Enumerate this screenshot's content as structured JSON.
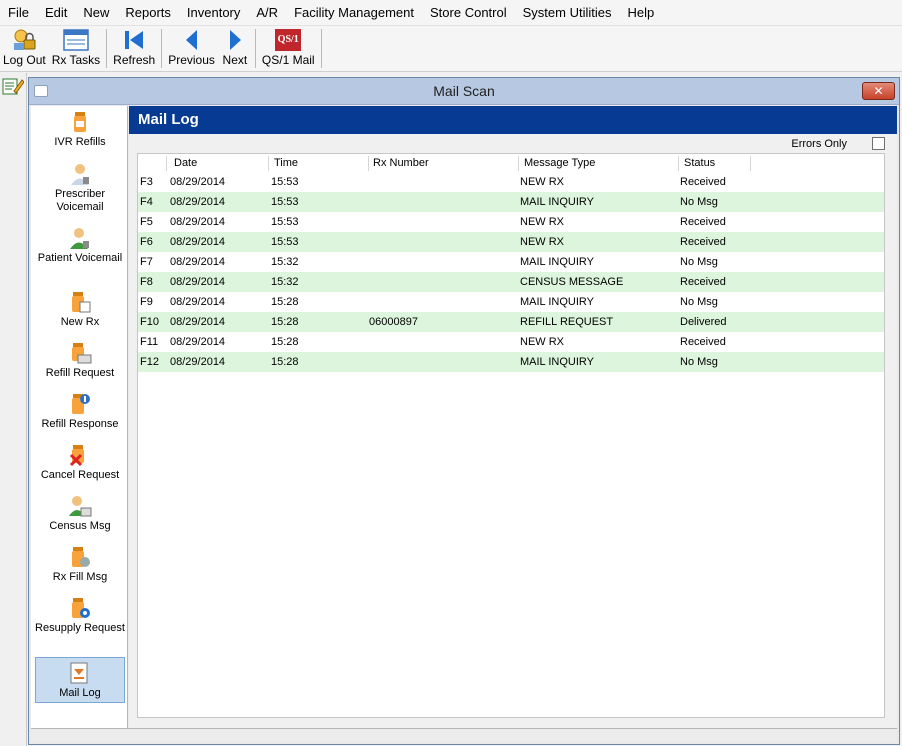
{
  "menu": [
    "File",
    "Edit",
    "New",
    "Reports",
    "Inventory",
    "A/R",
    "Facility Management",
    "Store Control",
    "System Utilities",
    "Help"
  ],
  "toolbar": {
    "logout": "Log Out",
    "rx_tasks": "Rx Tasks",
    "refresh": "Refresh",
    "previous": "Previous",
    "next": "Next",
    "qs1_mail": "QS/1 Mail",
    "qs1_logo": "QS/1"
  },
  "window": {
    "title": "Mail Scan",
    "close": "✕"
  },
  "nav": {
    "items": [
      {
        "label": "IVR Refills",
        "icon": "pill-bottle-icon"
      },
      {
        "label": "Prescriber Voicemail",
        "icon": "doctor-icon"
      },
      {
        "label": "Patient Voicemail",
        "icon": "patient-icon"
      },
      {
        "label": "New Rx",
        "icon": "new-rx-icon"
      },
      {
        "label": "Refill Request",
        "icon": "refill-request-icon"
      },
      {
        "label": "Refill Response",
        "icon": "refill-response-icon"
      },
      {
        "label": "Cancel Request",
        "icon": "cancel-request-icon"
      },
      {
        "label": "Census Msg",
        "icon": "census-icon"
      },
      {
        "label": "Rx Fill Msg",
        "icon": "rx-fill-icon"
      },
      {
        "label": "Resupply Request",
        "icon": "resupply-icon"
      },
      {
        "label": "Mail Log",
        "icon": "mail-log-icon"
      }
    ],
    "active": "Mail Log"
  },
  "mail_log": {
    "title": "Mail Log",
    "errors_only_label": "Errors Only",
    "errors_only_checked": false,
    "columns": [
      "Date",
      "Time",
      "Rx Number",
      "Message Type",
      "Status"
    ],
    "rows": [
      {
        "key": "F3",
        "date": "08/29/2014",
        "time": "15:53",
        "rx": "",
        "type": "NEW RX",
        "status": "Received"
      },
      {
        "key": "F4",
        "date": "08/29/2014",
        "time": "15:53",
        "rx": "",
        "type": "MAIL INQUIRY",
        "status": "No Msg"
      },
      {
        "key": "F5",
        "date": "08/29/2014",
        "time": "15:53",
        "rx": "",
        "type": "NEW RX",
        "status": "Received"
      },
      {
        "key": "F6",
        "date": "08/29/2014",
        "time": "15:53",
        "rx": "",
        "type": "NEW RX",
        "status": "Received"
      },
      {
        "key": "F7",
        "date": "08/29/2014",
        "time": "15:32",
        "rx": "",
        "type": "MAIL INQUIRY",
        "status": "No Msg"
      },
      {
        "key": "F8",
        "date": "08/29/2014",
        "time": "15:32",
        "rx": "",
        "type": "CENSUS MESSAGE",
        "status": "Received"
      },
      {
        "key": "F9",
        "date": "08/29/2014",
        "time": "15:28",
        "rx": "",
        "type": "MAIL INQUIRY",
        "status": "No Msg"
      },
      {
        "key": "F10",
        "date": "08/29/2014",
        "time": "15:28",
        "rx": "06000897",
        "type": "REFILL REQUEST",
        "status": "Delivered"
      },
      {
        "key": "F11",
        "date": "08/29/2014",
        "time": "15:28",
        "rx": "",
        "type": "NEW RX",
        "status": "Received"
      },
      {
        "key": "F12",
        "date": "08/29/2014",
        "time": "15:28",
        "rx": "",
        "type": "MAIL INQUIRY",
        "status": "No Msg"
      }
    ]
  },
  "colors": {
    "header_bg": "#063a93",
    "row_alt": "#ddf5dd",
    "active_nav": "#c7dcf1"
  }
}
